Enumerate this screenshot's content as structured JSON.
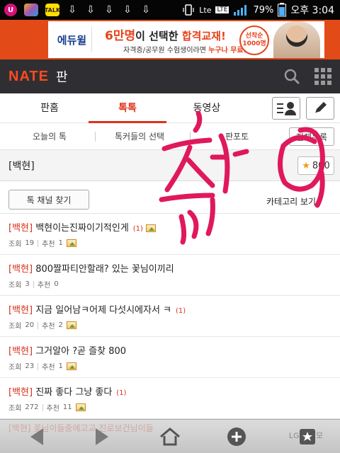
{
  "status_bar": {
    "battery": "79%",
    "network": "LTE",
    "network_prefix": "Lte",
    "time": "오후 3:04"
  },
  "ad_banner": {
    "logo": "에듀윌",
    "headline_highlight": "6만명",
    "headline_rest": "이 선택한 ",
    "headline_bold": "합격교재!",
    "sub_text": "자격증/공무원 수험생이라면 ",
    "sub_highlight": "누구나 무료!",
    "badge": "선착순 1000명"
  },
  "app_header": {
    "logo": "NATE",
    "section": "판"
  },
  "main_tabs": [
    {
      "label": "판홈"
    },
    {
      "label": "톡톡"
    },
    {
      "label": "동영상"
    }
  ],
  "sub_tabs": [
    {
      "label": "오늘의 톡"
    },
    {
      "label": "톡커들의 선택"
    },
    {
      "label": "판포토"
    }
  ],
  "sub_button": "전체목록",
  "channel": {
    "title": "[백현]",
    "fav_count": "800"
  },
  "find_button": "톡 채널 찾기",
  "category_link": "카테고리 보기",
  "posts": [
    {
      "tag": "[백현]",
      "title": "백현이는진짜이기적인게",
      "comments": "(1)",
      "views_label": "조회",
      "views": "19",
      "recs_label": "추천",
      "recs": "1",
      "has_image": true
    },
    {
      "tag": "[백현]",
      "title": "800짤파티안할래? 있는 꽃님이끼리",
      "comments": "",
      "views_label": "조회",
      "views": "3",
      "recs_label": "추천",
      "recs": "0",
      "has_image": false
    },
    {
      "tag": "[백현]",
      "title": "지금 일어남ㅋ어제 다섯시에자서 ㅋ",
      "comments": "(1)",
      "views_label": "조회",
      "views": "20",
      "recs_label": "추천",
      "recs": "2",
      "has_image": true
    },
    {
      "tag": "[백현]",
      "title": "그거알아 ?곧 즐찾 800",
      "comments": "",
      "views_label": "조회",
      "views": "23",
      "recs_label": "추천",
      "recs": "1",
      "has_image": true
    },
    {
      "tag": "[백현]",
      "title": "진짜 좋다 그냥 좋다",
      "comments": "(1)",
      "views_label": "조회",
      "views": "272",
      "recs_label": "추천",
      "recs": "11",
      "has_image": true
    }
  ],
  "ghost_post": "[백현] 꽃님이들중에고교 진로보건님이들",
  "nav_bar": {
    "brand": "LG 퀵메모"
  },
  "annotation": {
    "text": "축",
    "color": "#e0185c"
  }
}
